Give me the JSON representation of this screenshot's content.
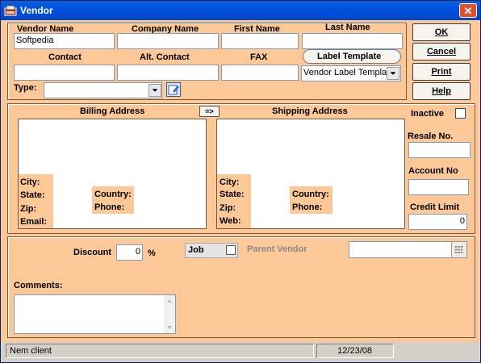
{
  "window": {
    "title": "Vendor",
    "close_glyph": "✕"
  },
  "header": {
    "vendor_name_label": "Vendor Name",
    "vendor_name_value": "Softpedia",
    "company_name_label": "Company Name",
    "first_name_label": "First Name",
    "last_name_label": "Last Name",
    "contact_label": "Contact",
    "alt_contact_label": "Alt. Contact",
    "fax_label": "FAX",
    "label_template_button": "Label Template",
    "label_template_value": "Vendor Label Templat",
    "type_label": "Type:"
  },
  "buttons": {
    "ok": "OK",
    "cancel": "Cancel",
    "print": "Print",
    "help": "Help"
  },
  "billing": {
    "title": "Billing Address",
    "copy_button": "=>",
    "city": "City:",
    "state": "State:",
    "zip": "Zip:",
    "email": "Email:",
    "country": "Country:",
    "phone": "Phone:"
  },
  "shipping": {
    "title": "Shipping Address",
    "city": "City:",
    "state": "State:",
    "zip": "Zip:",
    "web": "Web:",
    "country": "Country:",
    "phone": "Phone:"
  },
  "side": {
    "inactive_label": "Inactive",
    "resale_label": "Resale No.",
    "account_label": "Account No",
    "credit_label": "Credit Limit",
    "credit_value": "0"
  },
  "bottom": {
    "discount_label": "Discount",
    "discount_value": "0",
    "percent": "%",
    "job_label": "Job",
    "parent_vendor_label": "Parent Vendor",
    "comments_label": "Comments:"
  },
  "status": {
    "left": "Nem client",
    "date": "12/23/08"
  },
  "icons": {
    "close": "close-icon",
    "dropdown": "chevron-down-icon",
    "edit": "edit-icon",
    "list": "list-icon",
    "app": "vendor-app-icon"
  }
}
